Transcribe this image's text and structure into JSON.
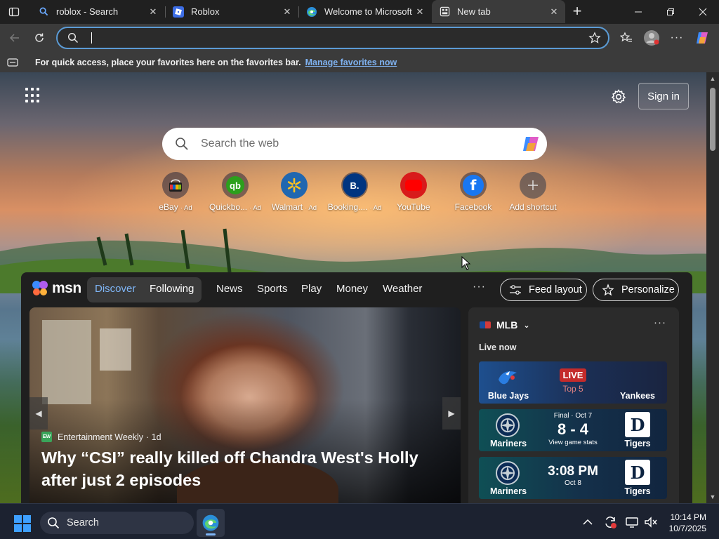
{
  "browser": {
    "tabs": [
      {
        "title": "roblox - Search",
        "favicon": "search-icon",
        "active": false
      },
      {
        "title": "Roblox",
        "favicon": "roblox-icon",
        "active": false
      },
      {
        "title": "Welcome to Microsoft Edge",
        "favicon": "edge-icon",
        "active": false
      },
      {
        "title": "New tab",
        "favicon": "newtab-icon",
        "active": true
      }
    ],
    "new_tab_symbol": "+",
    "address": {
      "value": "",
      "placeholder": ""
    },
    "favorites_bar": {
      "message": "For quick access, place your favorites here on the favorites bar.",
      "link": "Manage favorites now"
    }
  },
  "newtab": {
    "signin_label": "Sign in",
    "search_placeholder": "Search the web",
    "shortcuts": [
      {
        "label": "eBay",
        "ad": "· Ad",
        "icon": "ebay-icon",
        "color": "#f5a623"
      },
      {
        "label": "Quickbo...",
        "ad": "· Ad",
        "icon": "quickbooks-icon",
        "color": "#2ca01c"
      },
      {
        "label": "Walmart",
        "ad": "· Ad",
        "icon": "walmart-icon",
        "color": "#0071ce"
      },
      {
        "label": "Booking....",
        "ad": "· Ad",
        "icon": "booking-icon",
        "color": "#003580"
      },
      {
        "label": "YouTube",
        "ad": "",
        "icon": "youtube-icon",
        "color": "#ff0000"
      },
      {
        "label": "Facebook",
        "ad": "",
        "icon": "facebook-icon",
        "color": "#1877f2"
      },
      {
        "label": "Add shortcut",
        "ad": "",
        "icon": "plus-icon",
        "color": "#666666"
      }
    ]
  },
  "msn": {
    "logo_text": "msn",
    "segments": [
      {
        "label": "Discover",
        "selected": true
      },
      {
        "label": "Following",
        "selected": false
      }
    ],
    "nav": [
      "News",
      "Sports",
      "Play",
      "Money",
      "Weather"
    ],
    "more": "···",
    "feed_layout_label": "Feed layout",
    "personalize_label": "Personalize",
    "hero": {
      "source": "Entertainment Weekly",
      "source_badge": "EW",
      "age": "· 1d",
      "title": "Why “CSI” really killed off Chandra West's Holly after just 2 episodes"
    },
    "mlb": {
      "title": "MLB",
      "section": "Live now",
      "games": [
        {
          "away": "Blue Jays",
          "home": "Yankees",
          "status": "LIVE",
          "inning": "Top 5"
        },
        {
          "away": "Mariners",
          "home": "Tigers",
          "status": "Final · Oct 7",
          "score": "8 - 4",
          "link": "View game stats"
        },
        {
          "away": "Mariners",
          "home": "Tigers",
          "time": "3:08 PM",
          "date": "Oct 8"
        }
      ]
    }
  },
  "taskbar": {
    "search_label": "Search",
    "time": "10:14 PM",
    "date": "10/7/2025"
  },
  "colors": {
    "accent": "#5b9bd5",
    "link": "#7fb2f0",
    "live": "#c42b2b"
  }
}
